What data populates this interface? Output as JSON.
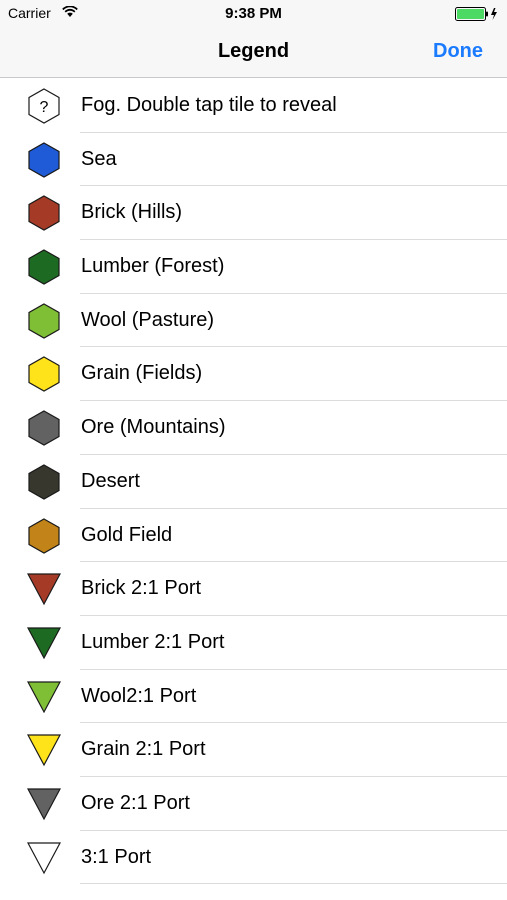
{
  "status_bar": {
    "carrier": "Carrier",
    "time": "9:38 PM",
    "wifi_icon": "wifi-icon",
    "battery_icon": "battery-charging-icon",
    "battery_color": "#4cd964"
  },
  "nav": {
    "title": "Legend",
    "done_label": "Done",
    "accent_color": "#1b7bff"
  },
  "items": [
    {
      "label": "Fog. Double tap tile to reveal",
      "shape": "hexagon",
      "color": "#ffffff",
      "glyph": "?"
    },
    {
      "label": "Sea",
      "shape": "hexagon",
      "color": "#1f5bd6"
    },
    {
      "label": "Brick (Hills)",
      "shape": "hexagon",
      "color": "#a53b27"
    },
    {
      "label": "Lumber (Forest)",
      "shape": "hexagon",
      "color": "#1d6b22"
    },
    {
      "label": "Wool (Pasture)",
      "shape": "hexagon",
      "color": "#7fbf35"
    },
    {
      "label": "Grain (Fields)",
      "shape": "hexagon",
      "color": "#ffe31a"
    },
    {
      "label": "Ore (Mountains)",
      "shape": "hexagon",
      "color": "#626262"
    },
    {
      "label": "Desert",
      "shape": "hexagon",
      "color": "#37372e"
    },
    {
      "label": "Gold Field",
      "shape": "hexagon",
      "color": "#c28418"
    },
    {
      "label": "Brick 2:1 Port",
      "shape": "triangle",
      "color": "#a53b27"
    },
    {
      "label": "Lumber 2:1 Port",
      "shape": "triangle",
      "color": "#1d6b22"
    },
    {
      "label": "Wool2:1 Port",
      "shape": "triangle",
      "color": "#7fbf35"
    },
    {
      "label": "Grain 2:1 Port",
      "shape": "triangle",
      "color": "#ffe31a"
    },
    {
      "label": "Ore 2:1 Port",
      "shape": "triangle",
      "color": "#626262"
    },
    {
      "label": "3:1 Port",
      "shape": "triangle",
      "color": "#ffffff"
    }
  ]
}
